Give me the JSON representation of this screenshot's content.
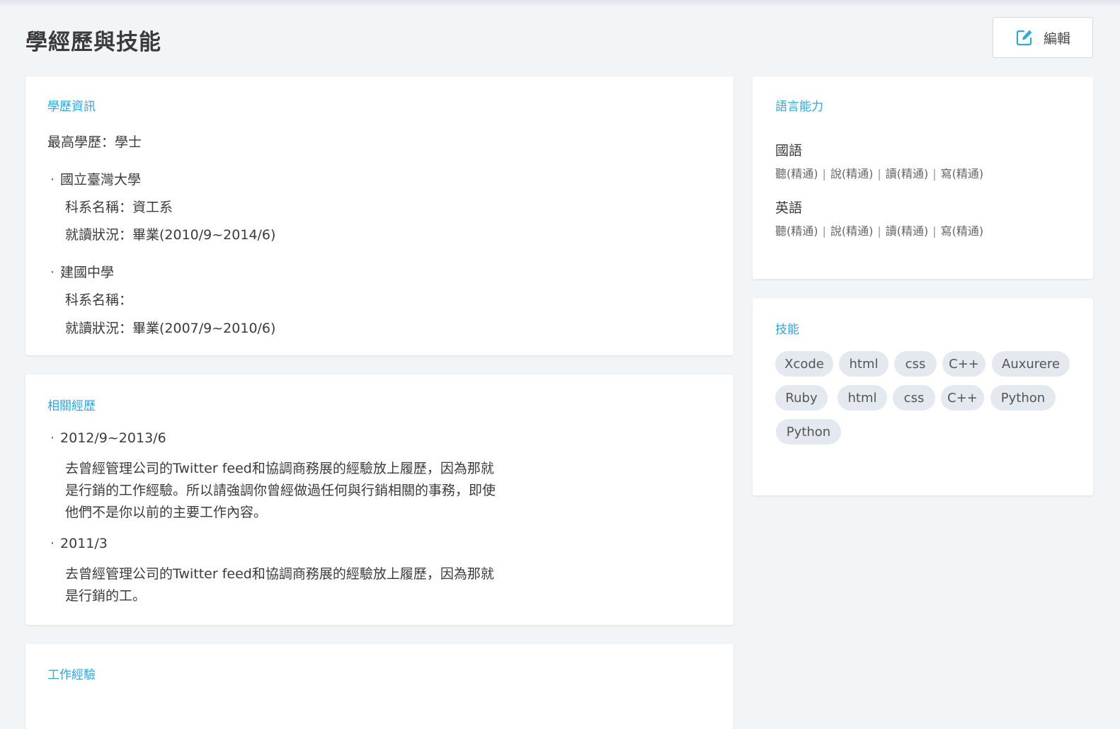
{
  "page": {
    "title": "學經歷與技能"
  },
  "toolbar": {
    "edit_label": "編輯",
    "edit_icon": "edit-icon"
  },
  "education": {
    "title": "學歷資訊",
    "highest_degree": "最高學歷：學士",
    "schools": [
      {
        "name": "國立臺灣大學",
        "department": "科系名稱：資工系",
        "status": "就讀狀況：畢業(2010/9~2014/6)"
      },
      {
        "name": "建國中學",
        "department": "科系名稱：",
        "status": "就讀狀況：畢業(2007/9~2010/6)"
      }
    ]
  },
  "experience": {
    "title": "相關經歷",
    "items": [
      {
        "period": "2012/9~2013/6",
        "desc": "去曾經管理公司的Twitter feed和協調商務展的經驗放上履歷，因為那就是行銷的工作經驗。所以請強調你曾經做過任何與行銷相關的事務，即使他們不是你以前的主要工作內容。"
      },
      {
        "period": "2011/3",
        "desc": "去曾經管理公司的Twitter feed和協調商務展的經驗放上履歷，因為那就是行銷的工。"
      }
    ]
  },
  "work": {
    "title": "工作經驗"
  },
  "languages": {
    "title": "語言能力",
    "items": [
      {
        "name": "國語",
        "listen": "聽(精通)",
        "speak": "說(精通)",
        "read": "讀(精通)",
        "write": "寫(精通)"
      },
      {
        "name": "英語",
        "listen": "聽(精通)",
        "speak": "說(精通)",
        "read": "讀(精通)",
        "write": "寫(精通)"
      }
    ]
  },
  "skills": {
    "title": "技能",
    "tags": [
      "Xcode",
      "html",
      "css",
      "C++",
      "Auxurere",
      "Ruby",
      "html",
      "css",
      "C++",
      "Python",
      "Python"
    ]
  },
  "colors": {
    "accent": "#2ea7d9",
    "background": "#f2f5f8",
    "chip": "#e3e9ef"
  }
}
